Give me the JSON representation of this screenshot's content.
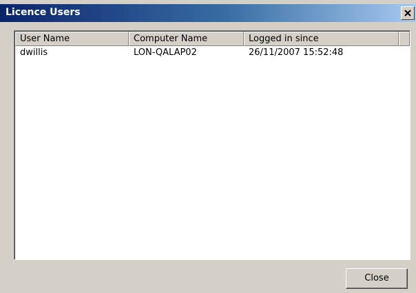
{
  "window": {
    "title": "Licence Users"
  },
  "list": {
    "columns": [
      {
        "label": "User Name"
      },
      {
        "label": "Computer Name"
      },
      {
        "label": "Logged in since"
      }
    ],
    "rows": [
      [
        "dwillis",
        "LON-QALAP02",
        "26/11/2007 15:52:48"
      ]
    ]
  },
  "buttons": {
    "close_label": "Close"
  },
  "icons": {
    "close": "close-icon"
  },
  "colors": {
    "titlebar_start": "#0a246a",
    "titlebar_end": "#a6caf0",
    "face": "#d4d0c8"
  }
}
